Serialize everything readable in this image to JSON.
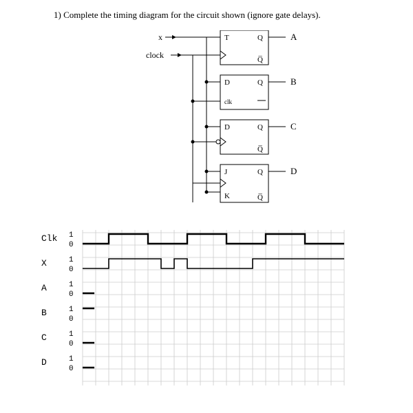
{
  "question_text": "1) Complete the timing diagram for the circuit shown (ignore gate delays).",
  "inputs": {
    "x": "x",
    "clock": "clock"
  },
  "flipflops": [
    {
      "type": "T",
      "in1": "T",
      "in2": "",
      "out": "A"
    },
    {
      "type": "D",
      "in1": "D",
      "in2": "clk",
      "out": "B"
    },
    {
      "type": "D",
      "in1": "D",
      "in2": "",
      "out": "C"
    },
    {
      "type": "JK",
      "in1": "J",
      "in2": "K",
      "out": "D"
    }
  ],
  "labels": {
    "Q": "Q",
    "Qbar": "Q̅"
  },
  "timing": {
    "grid_cols": 20,
    "signals": [
      {
        "name": "Clk",
        "levels": [
          "1",
          "0"
        ],
        "wave": [
          0,
          0,
          1,
          1,
          1,
          0,
          0,
          0,
          1,
          1,
          1,
          0,
          0,
          0,
          1,
          1,
          1,
          0,
          0,
          0
        ],
        "init_tick": true,
        "bold": true
      },
      {
        "name": "X",
        "levels": [
          "1",
          "0"
        ],
        "wave": [
          0,
          0,
          1,
          1,
          1,
          1,
          0,
          1,
          0,
          0,
          0,
          0,
          0,
          1,
          1,
          1,
          1,
          1,
          1,
          1
        ],
        "init_tick": true,
        "bold": false
      },
      {
        "name": "A",
        "levels": [
          "1",
          "0"
        ],
        "wave": [],
        "init_tick": true,
        "init_level": 0
      },
      {
        "name": "B",
        "levels": [
          "1",
          "0"
        ],
        "wave": [],
        "init_tick": true,
        "init_level": 1
      },
      {
        "name": "C",
        "levels": [
          "1",
          "0"
        ],
        "wave": [],
        "init_tick": true,
        "init_level": 0
      },
      {
        "name": "D",
        "levels": [
          "1",
          "0"
        ],
        "wave": [],
        "init_tick": true,
        "init_level": 0
      }
    ]
  }
}
